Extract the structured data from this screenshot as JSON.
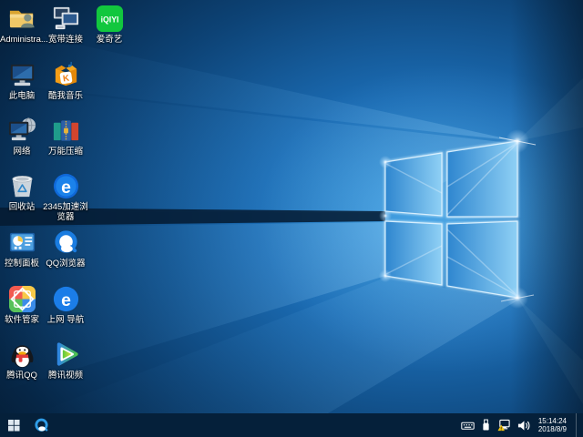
{
  "desktop": {
    "icons": [
      {
        "name": "administrator-folder",
        "label": "Administra..."
      },
      {
        "name": "broadband-connection",
        "label": "宽带连接"
      },
      {
        "name": "iqiyi",
        "label": "爱奇艺",
        "logo_text": "iQIYI"
      },
      {
        "name": "this-pc",
        "label": "此电脑"
      },
      {
        "name": "kuwo-music",
        "label": "酷我音乐",
        "logo_text": "K"
      },
      {
        "name": "network",
        "label": "网络"
      },
      {
        "name": "wanneng-archiver",
        "label": "万能压缩"
      },
      {
        "name": "recycle-bin",
        "label": "回收站"
      },
      {
        "name": "browser-2345",
        "label": "2345加速浏览器",
        "logo_text": "e"
      },
      {
        "name": "control-panel",
        "label": "控制面板"
      },
      {
        "name": "qq-browser",
        "label": "QQ浏览器"
      },
      {
        "name": "software-manager",
        "label": "软件管家"
      },
      {
        "name": "web-navigation",
        "label": "上网 导航",
        "logo_text": "e"
      },
      {
        "name": "tencent-qq",
        "label": "腾讯QQ"
      },
      {
        "name": "tencent-video",
        "label": "腾讯视频"
      }
    ]
  },
  "taskbar": {
    "tray": {
      "time": "15:14:24",
      "date": "2018/8/9",
      "icons": [
        "touch-keyboard",
        "usb-device",
        "network-warning",
        "volume"
      ]
    }
  }
}
